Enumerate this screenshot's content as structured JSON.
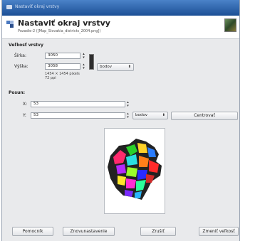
{
  "window": {
    "title": "Nastaviť okraj vrstvy"
  },
  "header": {
    "title": "Nastaviť okraj vrstvy",
    "subtitle": "Pozadie-2 ([Map_Slovakia_districts_2004.png])"
  },
  "layer_size": {
    "section_label": "Veľkosť vrstvy",
    "width_label": "Šírka:",
    "width_value": "3050",
    "height_label": "Výška:",
    "height_value": "3058",
    "unit": "bodov",
    "info_line1": "1454 × 1454 pixels",
    "info_line2": "72 ppi"
  },
  "offset": {
    "section_label": "Posun:",
    "x_label": "X:",
    "x_value": "53",
    "y_label": "Y:",
    "y_value": "53",
    "unit": "bodov",
    "center_button": "Centrovať"
  },
  "footer": {
    "help": "Pomocník",
    "reset": "Znovunastavenie",
    "cancel": "Zrušiť",
    "resize": "Zmeniť veľkosť"
  },
  "colors": {
    "titlebar": "#1f5aa8",
    "window_bg": "#e9eaec",
    "field_border": "#9aa0a8"
  },
  "icons": [
    "layer-resize-icon",
    "chain-link-icon",
    "spin-up-icon",
    "spin-down-icon",
    "dropdown-arrow-icon"
  ]
}
